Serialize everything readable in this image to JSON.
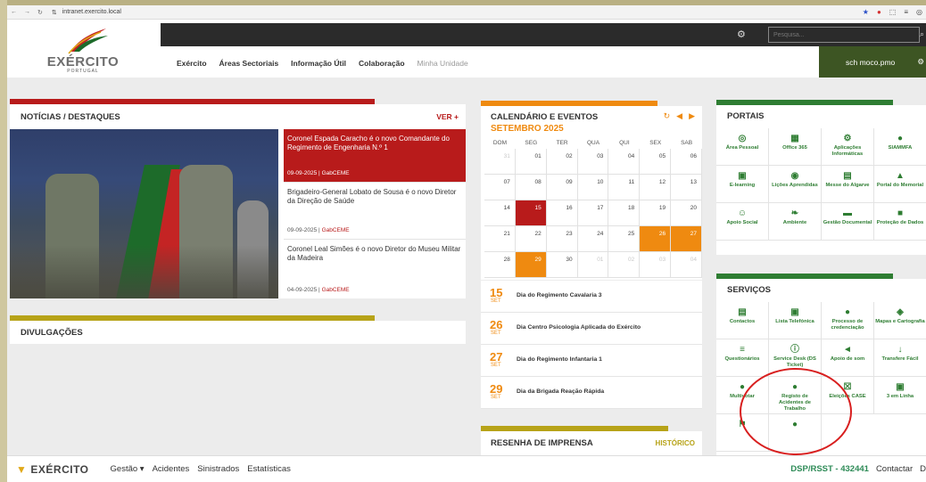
{
  "browser": {
    "url": "intranet.exercito.local",
    "nav_icons": [
      "←",
      "→",
      "↻",
      "⇅"
    ],
    "toolbar_icons": [
      "★",
      "●",
      "⬚",
      "≡",
      "◎"
    ]
  },
  "header": {
    "logo_text": "EXÉRCITO",
    "logo_sub": "PORTUGAL",
    "search_placeholder": "Pesquisa...",
    "search_icon": "⌕",
    "settings_icon": "⚙",
    "nav": [
      "Exército",
      "Áreas Sectoriais",
      "Informação Útil",
      "Colaboração",
      "Minha Unidade"
    ],
    "user": "sch moco.pmo",
    "user_icon": "⚙"
  },
  "news": {
    "title": "NOTÍCIAS / DESTAQUES",
    "more": "VER +",
    "items": [
      {
        "title": "Coronel Espada Caracho é o novo Comandante do Regimento de Engenharia N.º 1",
        "date": "09-09-2025",
        "source": "GabCEME"
      },
      {
        "title": "Brigadeiro-General Lobato de Sousa é o novo Diretor da Direção de Saúde",
        "date": "09-09-2025",
        "source": "GabCEME"
      },
      {
        "title": "Coronel Leal Simões é o novo Diretor do Museu Militar da Madeira",
        "date": "04-09-2025",
        "source": "GabCEME"
      }
    ]
  },
  "divulgacoes": {
    "title": "DIVULGAÇÕES"
  },
  "calendar": {
    "title": "CALENDÁRIO E EVENTOS",
    "month": "SETEMBRO 2025",
    "controls": [
      "↻",
      "◀",
      "▶"
    ],
    "weekdays": [
      "DOM",
      "SEG",
      "TER",
      "QUA",
      "QUI",
      "SEX",
      "SAB"
    ],
    "days": [
      {
        "d": "31",
        "t": "other"
      },
      {
        "d": "01",
        "t": ""
      },
      {
        "d": "02",
        "t": ""
      },
      {
        "d": "03",
        "t": ""
      },
      {
        "d": "04",
        "t": ""
      },
      {
        "d": "05",
        "t": ""
      },
      {
        "d": "06",
        "t": ""
      },
      {
        "d": "07",
        "t": ""
      },
      {
        "d": "08",
        "t": ""
      },
      {
        "d": "09",
        "t": ""
      },
      {
        "d": "10",
        "t": ""
      },
      {
        "d": "11",
        "t": ""
      },
      {
        "d": "12",
        "t": ""
      },
      {
        "d": "13",
        "t": ""
      },
      {
        "d": "14",
        "t": ""
      },
      {
        "d": "15",
        "t": "today"
      },
      {
        "d": "16",
        "t": ""
      },
      {
        "d": "17",
        "t": ""
      },
      {
        "d": "18",
        "t": ""
      },
      {
        "d": "19",
        "t": ""
      },
      {
        "d": "20",
        "t": ""
      },
      {
        "d": "21",
        "t": ""
      },
      {
        "d": "22",
        "t": ""
      },
      {
        "d": "23",
        "t": ""
      },
      {
        "d": "24",
        "t": ""
      },
      {
        "d": "25",
        "t": ""
      },
      {
        "d": "26",
        "t": "weekend"
      },
      {
        "d": "27",
        "t": "weekend"
      },
      {
        "d": "28",
        "t": ""
      },
      {
        "d": "29",
        "t": "weekend"
      },
      {
        "d": "30",
        "t": ""
      },
      {
        "d": "01",
        "t": "other"
      },
      {
        "d": "02",
        "t": "other"
      },
      {
        "d": "03",
        "t": "other"
      },
      {
        "d": "04",
        "t": "other"
      }
    ],
    "events": [
      {
        "day": "15",
        "month": "SET",
        "title": "Dia do Regimento Cavalaria 3"
      },
      {
        "day": "26",
        "month": "SET",
        "title": "Dia Centro Psicologia Aplicada do Exército"
      },
      {
        "day": "27",
        "month": "SET",
        "title": "Dia do Regimento Infantaria 1"
      },
      {
        "day": "29",
        "month": "SET",
        "title": "Dia da Brigada Reação Rápida"
      }
    ]
  },
  "resenha": {
    "title": "RESENHA DE IMPRENSA",
    "link": "HISTÓRICO"
  },
  "portais": {
    "title": "PORTAIS",
    "items": [
      {
        "icon": "◎",
        "label": "Área Pessoal"
      },
      {
        "icon": "▦",
        "label": "Office 365"
      },
      {
        "icon": "⚙",
        "label": "Aplicações Informáticas"
      },
      {
        "icon": "●",
        "label": "SIAMMFA"
      },
      {
        "icon": "▣",
        "label": "E-learning"
      },
      {
        "icon": "◉",
        "label": "Lições Aprendidas"
      },
      {
        "icon": "▤",
        "label": "Messe do Algarve"
      },
      {
        "icon": "▲",
        "label": "Portal do Memorial"
      },
      {
        "icon": "☺",
        "label": "Apoio Social"
      },
      {
        "icon": "❧",
        "label": "Ambiente"
      },
      {
        "icon": "▬",
        "label": "Gestão Documental"
      },
      {
        "icon": "■",
        "label": "Proteção de Dados"
      }
    ]
  },
  "servicos": {
    "title": "SERVIÇOS",
    "items": [
      {
        "icon": "▤",
        "label": "Contactos"
      },
      {
        "icon": "▣",
        "label": "Lista Telefónica"
      },
      {
        "icon": "●",
        "label": "Processo de credenciação"
      },
      {
        "icon": "◈",
        "label": "Mapas e Cartografia"
      },
      {
        "icon": "≡",
        "label": "Questionários"
      },
      {
        "icon": "ⓘ",
        "label": "Service Desk (DS Ticket)"
      },
      {
        "icon": "◄",
        "label": "Apoio de som"
      },
      {
        "icon": "↓",
        "label": "Transfere Fácil"
      },
      {
        "icon": "●",
        "label": "Multivotar"
      },
      {
        "icon": "●",
        "label": "Registo de Acidentes de Trabalho"
      },
      {
        "icon": "☒",
        "label": "Eleições CASE"
      },
      {
        "icon": "▣",
        "label": "3 em Linha"
      },
      {
        "icon": "⚑",
        "label": ""
      },
      {
        "icon": "●",
        "label": ""
      }
    ]
  },
  "bottombar": {
    "logo": "EXÉRCITO",
    "nav": [
      "Gestão ▾",
      "Acidentes",
      "Sinistrados",
      "Estatísticas"
    ],
    "dsp": "DSP/RSST - 432441",
    "contact": "Contactar",
    "extra": "D"
  },
  "colors": {
    "red": "#b81b1b",
    "orange": "#ef8a10",
    "green": "#2e7d32",
    "olive": "#b7a318",
    "dark": "#2b2b2b",
    "user_bg": "#3d5523"
  }
}
